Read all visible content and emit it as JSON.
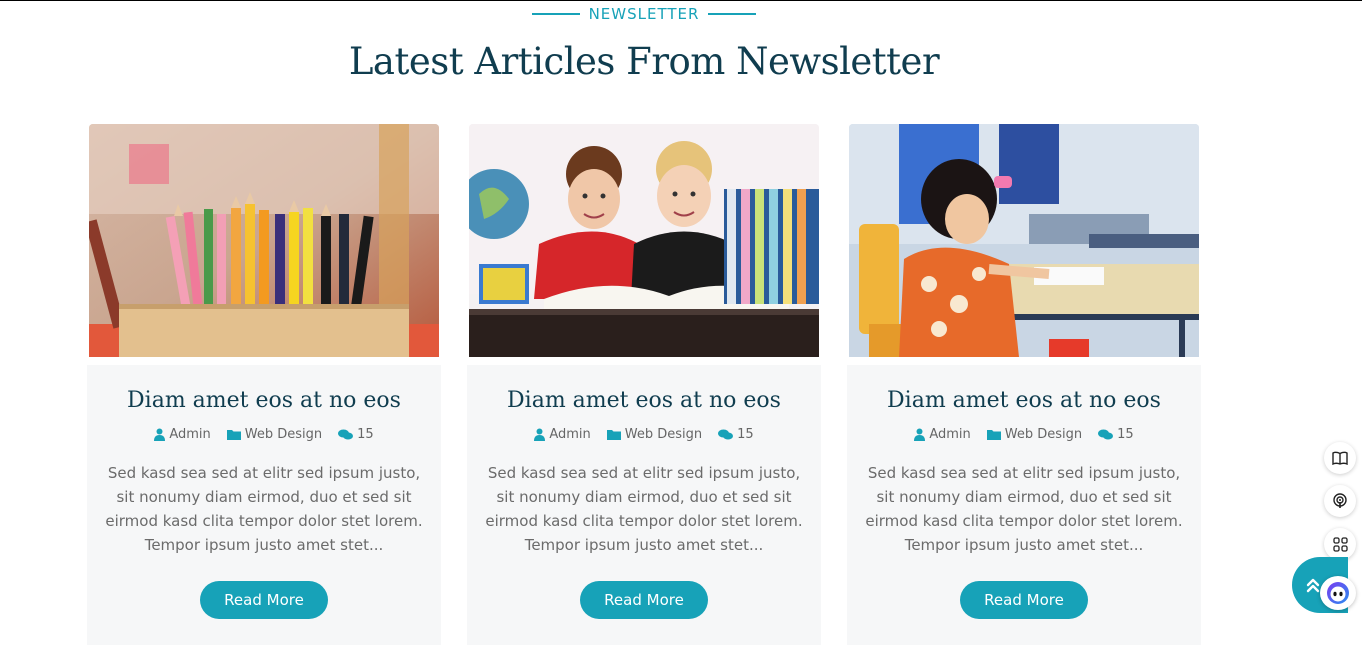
{
  "section": {
    "label": "NEWSLETTER",
    "title": "Latest Articles From Newsletter"
  },
  "articles": [
    {
      "title": "Diam amet eos at no eos",
      "author": "Admin",
      "category": "Web Design",
      "comments": "15",
      "description": "Sed kasd sea sed at elitr sed ipsum justo, sit nonumy diam eirmod, duo et sed sit eirmod kasd clita tempor dolor stet lorem. Tempor ipsum justo amet stet...",
      "button": "Read More",
      "image": "colored-pencils-photo"
    },
    {
      "title": "Diam amet eos at no eos",
      "author": "Admin",
      "category": "Web Design",
      "comments": "15",
      "description": "Sed kasd sea sed at elitr sed ipsum justo, sit nonumy diam eirmod, duo et sed sit eirmod kasd clita tempor dolor stet lorem. Tempor ipsum justo amet stet...",
      "button": "Read More",
      "image": "two-boys-with-books-photo"
    },
    {
      "title": "Diam amet eos at no eos",
      "author": "Admin",
      "category": "Web Design",
      "comments": "15",
      "description": "Sed kasd sea sed at elitr sed ipsum justo, sit nonumy diam eirmod, duo et sed sit eirmod kasd clita tempor dolor stet lorem. Tempor ipsum justo amet stet...",
      "button": "Read More",
      "image": "girl-writing-in-classroom-photo"
    }
  ],
  "floating": {
    "icons": [
      "book-icon",
      "podcast-icon",
      "grid-icon"
    ],
    "scroll_top_icon": "double-chevron-up-icon",
    "assistant_icon": "assistant-face-icon"
  },
  "colors": {
    "accent": "#17a2b8",
    "heading": "#103d4f",
    "body_text": "#6b6b6b",
    "card_bg": "#f6f7f8"
  }
}
